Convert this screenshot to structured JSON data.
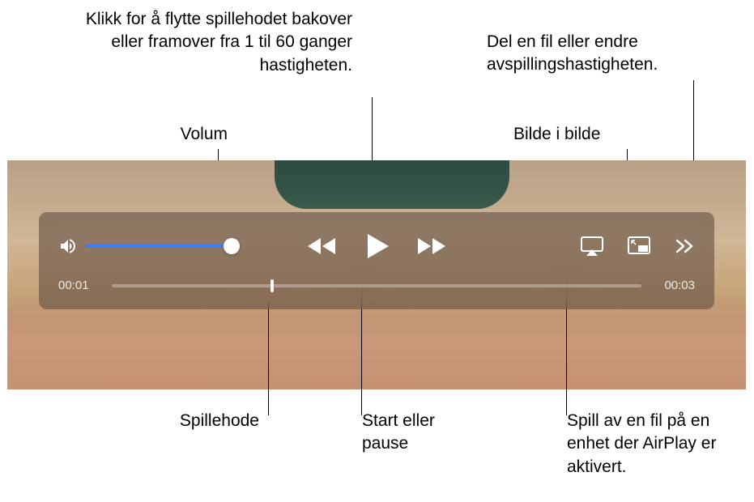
{
  "callouts": {
    "scrub": "Klikk for å flytte spillehodet bakover eller framover fra 1 til 60 ganger hastigheten.",
    "volume": "Volum",
    "share": "Del en fil eller endre avspillingshastigheten.",
    "pip": "Bilde i bilde",
    "playhead": "Spillehode",
    "playpause": "Start eller pause",
    "airplay": "Spill av en fil på en enhet der AirPlay er aktivert."
  },
  "player": {
    "currentTime": "00:01",
    "remainingTime": "00:03",
    "volumePercent": 100,
    "playheadPercent": 30
  }
}
